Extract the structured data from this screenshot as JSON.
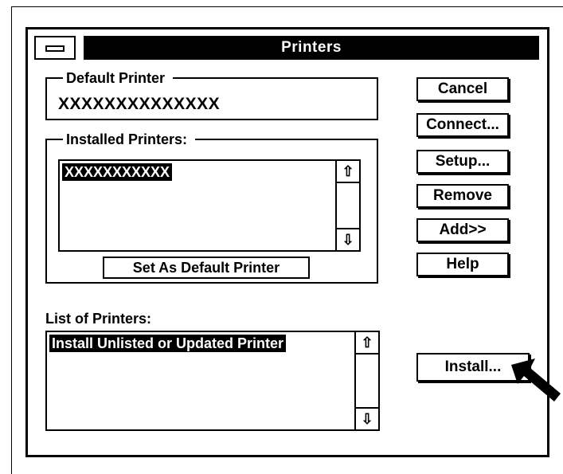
{
  "dialog": {
    "title": "Printers"
  },
  "default_printer": {
    "label": "Default Printer",
    "value": "XXXXXXXXXXXXXX"
  },
  "installed_printers": {
    "label": "Installed Printers:",
    "items": [
      "XXXXXXXXXXX"
    ],
    "set_default_label": "Set As Default Printer"
  },
  "list_of_printers": {
    "label": "List of Printers:",
    "items": [
      "Install Unlisted or Updated Printer"
    ]
  },
  "buttons": {
    "cancel": "Cancel",
    "connect": "Connect...",
    "setup": "Setup...",
    "remove": "Remove",
    "add": "Add>>",
    "help": "Help",
    "install": "Install..."
  },
  "icons": {
    "scroll_up": "up-arrow-icon",
    "scroll_down": "down-arrow-icon",
    "system_menu": "system-menu-icon",
    "pointer_arrow": "pointer-arrow-icon"
  },
  "colors": {
    "foreground": "#000000",
    "background": "#ffffff"
  }
}
